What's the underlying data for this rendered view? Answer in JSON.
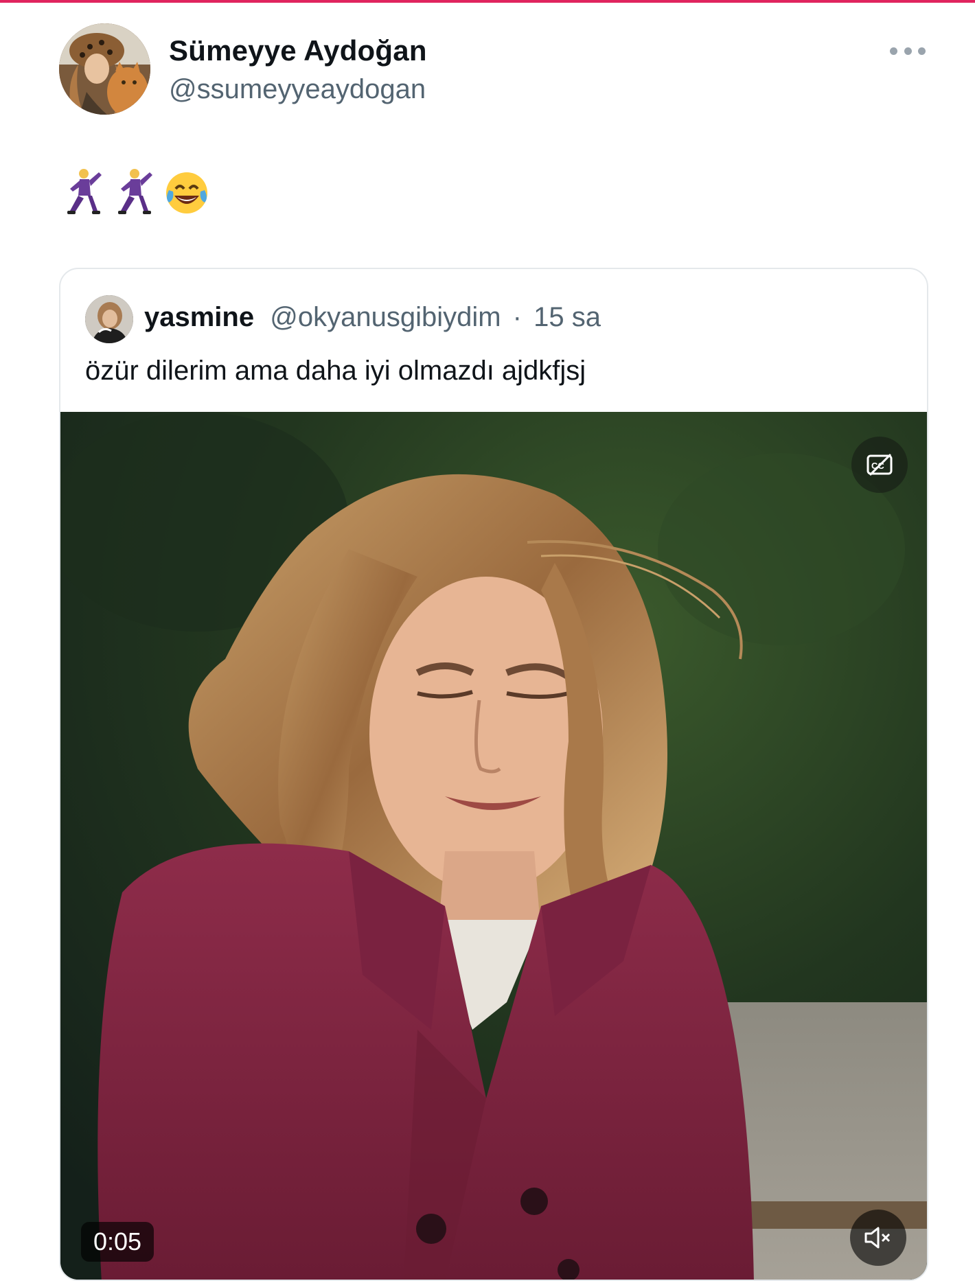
{
  "tweet": {
    "author": {
      "display_name": "Sümeyye Aydoğan",
      "handle": "@ssumeyyeaydogan",
      "avatar_icon": "profile-photo-with-cat"
    },
    "more_icon": "more-horizontal-icon",
    "body_emojis": [
      "man-dancing-emoji",
      "man-dancing-emoji",
      "face-with-tears-of-joy-emoji"
    ]
  },
  "quoted_tweet": {
    "author": {
      "display_name": "yasmine",
      "handle": "@okyanusgibiydim",
      "separator": "·",
      "time": "15 sa",
      "avatar_icon": "profile-photo"
    },
    "text": "özür dilerim ama daha iyi olmazdı ajdkfjsj",
    "video": {
      "timestamp": "0:05",
      "captions_icon": "captions-off-icon",
      "mute_icon": "muted-speaker-icon"
    }
  },
  "colors": {
    "accent_strip": "#e0245e",
    "text_primary": "#0f1419",
    "text_secondary": "#536471",
    "border": "#e4e8eb"
  }
}
